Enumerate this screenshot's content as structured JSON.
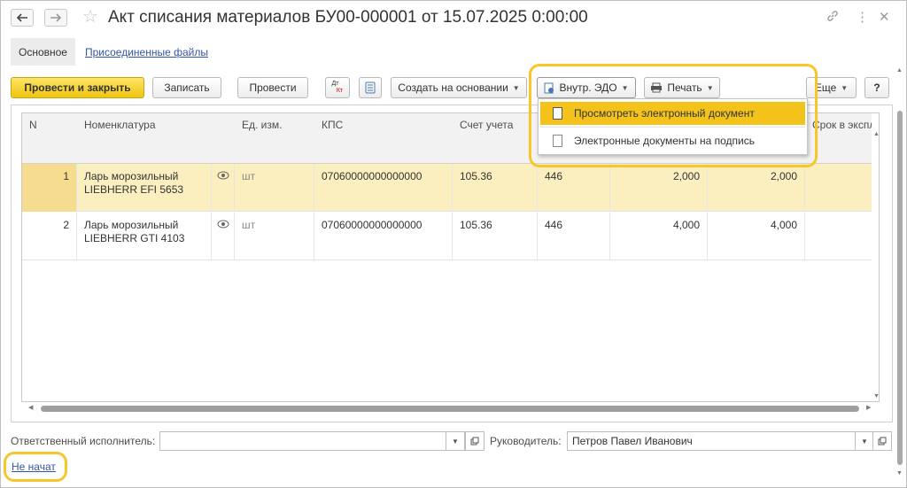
{
  "window": {
    "title": "Акт списания материалов БУ00-000001 от 15.07.2025 0:00:00",
    "icons": [
      "back-arrow-icon",
      "forward-arrow-icon",
      "star-icon",
      "link-icon",
      "more-icon",
      "close-icon"
    ]
  },
  "tabs": {
    "main": "Основное",
    "files": "Присоединенные файлы"
  },
  "toolbar": {
    "post_close": "Провести и закрыть",
    "save": "Записать",
    "post": "Провести",
    "dtkt_top": "Дт",
    "dtkt_bottom": "Кт",
    "create_based": "Создать на основании",
    "edo": "Внутр. ЭДО",
    "print": "Печать",
    "more": "Еще",
    "help": "?"
  },
  "edo_menu": {
    "items": [
      "Просмотреть электронный документ",
      "Электронные документы на подпись"
    ]
  },
  "table": {
    "columns": [
      "N",
      "Номенклатура",
      "",
      "Ед. изм.",
      "КПС",
      "Счет учета",
      "",
      "",
      "",
      "Срок в экспл"
    ],
    "rows": [
      {
        "n": "1",
        "item_line1": "Ларь морозильный",
        "item_line2": "LIEBHERR EFI 5653",
        "unit": "шт",
        "kps": "07060000000000000",
        "account": "105.36",
        "code": "446",
        "qty1": "2,000",
        "qty2": "2,000"
      },
      {
        "n": "2",
        "item_line1": "Ларь морозильный",
        "item_line2": "LIEBHERR GTI 4103",
        "unit": "шт",
        "kps": "07060000000000000",
        "account": "105.36",
        "code": "446",
        "qty1": "4,000",
        "qty2": "4,000"
      }
    ]
  },
  "footer": {
    "responsible_label": "Ответственный исполнитель:",
    "responsible_value": "",
    "manager_label": "Руководитель:",
    "manager_value": "Петров Павел Иванович",
    "status_link": "Не начат"
  },
  "colors": {
    "accent_yellow": "#f1c40f",
    "highlight_ring": "#f7c52c",
    "selected_row": "#fbefc0",
    "link": "#3355aa"
  }
}
